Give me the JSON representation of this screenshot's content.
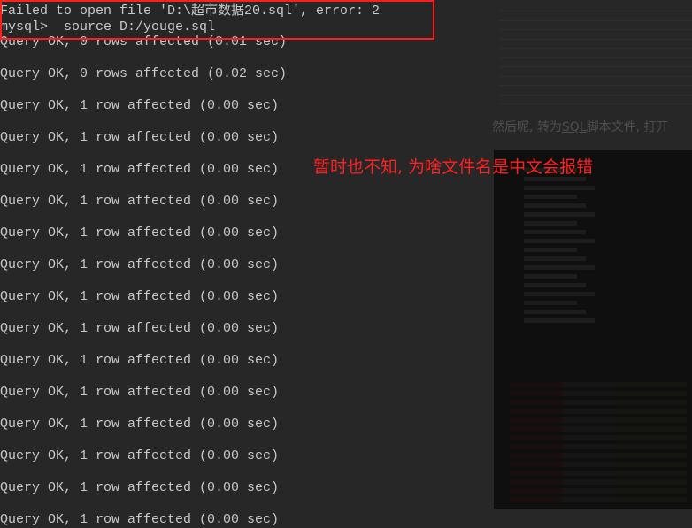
{
  "terminal": {
    "lines": [
      "Failed to open file 'D:\\超市数据20.sql', error: 2",
      "mysql>  source D:/youge.sql",
      "Query OK, 0 rows affected (0.01 sec)",
      "Query OK, 0 rows affected (0.02 sec)",
      "Query OK, 1 row affected (0.00 sec)",
      "Query OK, 1 row affected (0.00 sec)",
      "Query OK, 1 row affected (0.00 sec)",
      "Query OK, 1 row affected (0.00 sec)",
      "Query OK, 1 row affected (0.00 sec)",
      "Query OK, 1 row affected (0.00 sec)",
      "Query OK, 1 row affected (0.00 sec)",
      "Query OK, 1 row affected (0.00 sec)",
      "Query OK, 1 row affected (0.00 sec)",
      "Query OK, 1 row affected (0.00 sec)",
      "Query OK, 1 row affected (0.00 sec)",
      "Query OK, 1 row affected (0.00 sec)",
      "Query OK, 1 row affected (0.00 sec)",
      "Query OK, 1 row affected (0.00 sec)"
    ]
  },
  "annotation": {
    "text": "暂时也不知, 为啥文件名是中文会报错",
    "color": "#ff2020"
  },
  "blog": {
    "text_before": "然后呢, 转为",
    "text_link": "SQL",
    "text_after": "脚本文件, 打开"
  },
  "colors": {
    "highlight_box": "#ff1e1e",
    "terminal_text": "#c8c8c8"
  }
}
